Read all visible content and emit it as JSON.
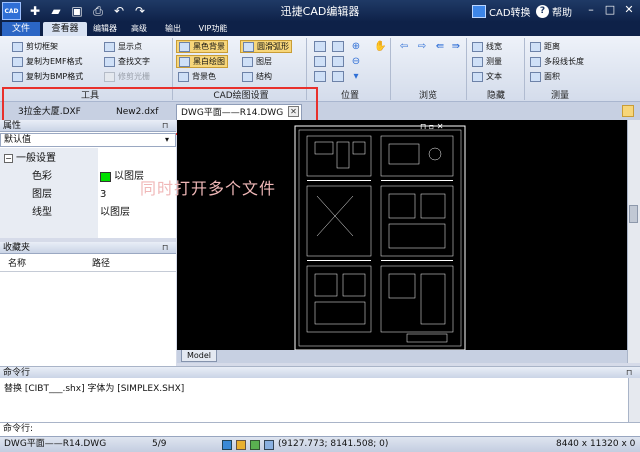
{
  "titlebar": {
    "logo": "CAD",
    "title": "迅捷CAD编辑器",
    "cad_convert": "CAD转换",
    "help": "帮助",
    "quick_access": [
      "new-file-icon",
      "open-folder-icon",
      "save-icon",
      "print-icon",
      "undo-icon",
      "redo-icon"
    ],
    "window_buttons": [
      "minimize-icon",
      "maximize-icon",
      "close-icon"
    ]
  },
  "menu": {
    "tabs": [
      {
        "label": "文件"
      },
      {
        "label": "查看器"
      },
      {
        "label": "编辑器"
      },
      {
        "label": "高级"
      },
      {
        "label": "输出"
      },
      {
        "label": "VIP功能"
      }
    ]
  },
  "ribbon": {
    "tools": {
      "label": "工具",
      "buttons": [
        {
          "label": "剪切框架"
        },
        {
          "label": "复制为EMF格式"
        },
        {
          "label": "复制为BMP格式"
        },
        {
          "label": "显示点"
        },
        {
          "label": "查找文字"
        },
        {
          "label": "修剪光栅",
          "disabled": true
        }
      ]
    },
    "cad_settings": {
      "label": "CAD绘图设置",
      "buttons": [
        {
          "label": "黑色背景"
        },
        {
          "label": "黑白绘图"
        },
        {
          "label": "背景色"
        },
        {
          "label": "圆滑弧形"
        },
        {
          "label": "图层"
        },
        {
          "label": "结构"
        }
      ]
    },
    "position": {
      "label": "位置"
    },
    "browse": {
      "label": "浏览"
    },
    "hide": {
      "label": "隐藏",
      "buttons": [
        {
          "label": "线宽"
        },
        {
          "label": "测量"
        },
        {
          "label": "文本"
        }
      ]
    },
    "measure": {
      "label": "测量",
      "buttons": [
        {
          "label": "距离"
        },
        {
          "label": "多段线长度"
        },
        {
          "label": "面积"
        }
      ]
    }
  },
  "file_tabs": [
    {
      "label": "3拉金大厦.DXF"
    },
    {
      "label": "New2.dxf"
    },
    {
      "label": "DWG平面——R14.DWG"
    }
  ],
  "properties": {
    "header": "属性",
    "dropdown": "默认值",
    "section": "一般设置",
    "rows": [
      {
        "key": "色彩",
        "value": "以图层",
        "swatch": "#00e000"
      },
      {
        "key": "图层",
        "value": "3"
      },
      {
        "key": "线型",
        "value": "以图层"
      }
    ]
  },
  "favorites": {
    "header": "收藏夹",
    "columns": [
      "名称",
      "路径"
    ]
  },
  "canvas": {
    "overlay_text": "同时打开多个文件",
    "model_tab": "Model"
  },
  "command": {
    "header": "命令行",
    "output": "替换 [CIBT___.shx] 字体为 [SIMPLEX.SHX]",
    "input_label": "命令行:"
  },
  "status": {
    "file": "DWG平面——R14.DWG",
    "page": "5/9",
    "coords": "(9127.773; 8141.508; 0)",
    "size": "8440 x 11320 x 0"
  }
}
